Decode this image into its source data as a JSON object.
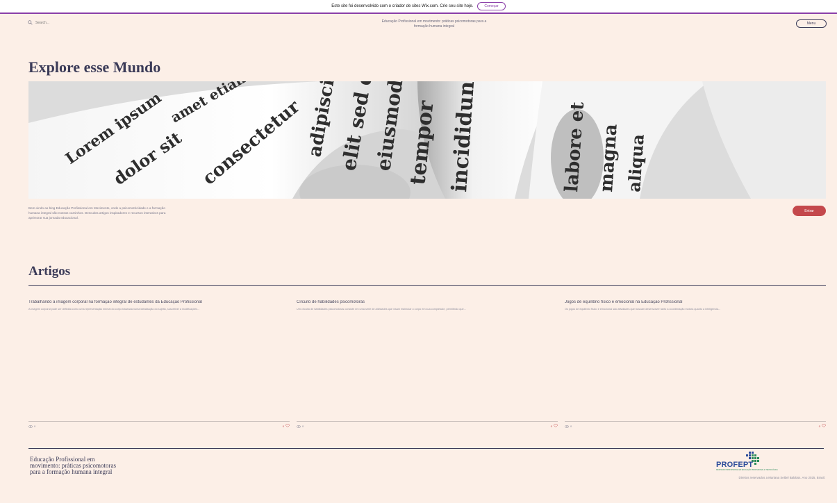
{
  "wix_banner": {
    "text": "Este site foi desenvolvido com o criador de sites Wix.com. Crie seu site hoje.",
    "button": "Começar"
  },
  "header": {
    "search_placeholder": "Search...",
    "tagline": "Educação Profissional em movimento: práticas psicomotoras para a formação humana integral",
    "menu": "Menu"
  },
  "hero": {
    "title": "Explore esse Mundo",
    "description": "Bem-vindo ao blog Educação Profissional em Movimento, onde a psicomotricidade e a formação humana integral são nossos caminhos. Descubra artigos inspiradores e recursos interativos para aprimorar sua jornada educacional.",
    "enter_button": "Entrar"
  },
  "articles": {
    "title": "Artigos",
    "items": [
      {
        "title": "Trabalhando a imagem corporal na formação integral de estudantes da Educação Profissional",
        "excerpt": "A imagem corporal pode ser definida como uma representação mental do corpo baseada numa idealização do sujeito, suscetível a modificações...",
        "views": "0",
        "likes": "0"
      },
      {
        "title": "Circuito de habilidades psicomotoras",
        "excerpt": "Um circuito de habilidades psicomotoras consiste em uma série de atividades que visam estimular o corpo em sua completude, permitindo que...",
        "views": "0",
        "likes": "0"
      },
      {
        "title": "Jogos de equilíbrio físico e emocional na Educação Profissional",
        "excerpt": "Os jogos de equilíbrio físico e emocional são atividades que buscam desenvolver tanto a coordenação motora quanto a inteligência...",
        "views": "0",
        "likes": "0"
      }
    ]
  },
  "footer": {
    "title": "Educação Profissional em movimento: práticas psicomotoras para a formação humana integral",
    "logo_text": "PROFEPT",
    "logo_subtext": "MESTRADO PROFISSIONAL EM EDUCAÇÃO PROFISSIONAL E TECNOLÓGICA",
    "copyright": "Direitos reservados a Mariana Seibel Baldüss. Ano 2025, Brasil."
  },
  "colors": {
    "background": "#fcefe7",
    "accent": "#c4484c",
    "text_dark": "#3b3b58",
    "wix_purple": "#8a3ea8"
  }
}
